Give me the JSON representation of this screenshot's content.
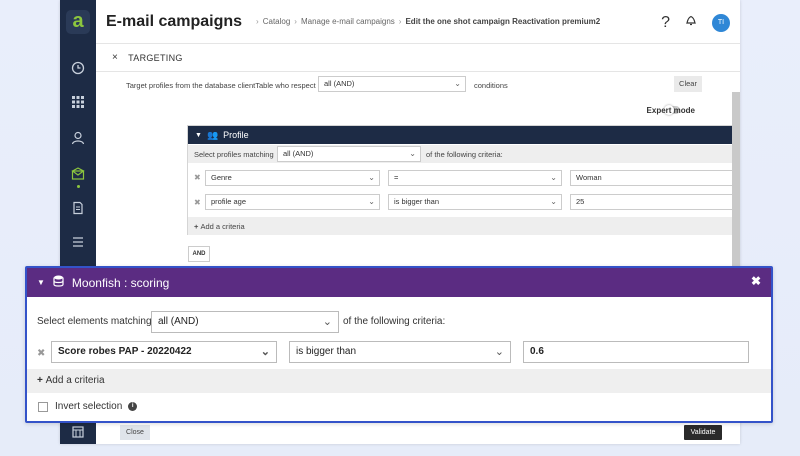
{
  "app": {
    "logo": "a",
    "title": "E-mail campaigns",
    "breadcrumb": [
      "Catalog",
      "Manage e-mail campaigns",
      "Edit the one shot campaign Reactivation premium2"
    ],
    "help": "?",
    "avatar": "TI"
  },
  "sidebar": {
    "icons": [
      "clock-icon",
      "grid-icon",
      "user-icon",
      "envelope-icon",
      "document-icon",
      "list-icon",
      "store-icon"
    ]
  },
  "targeting": {
    "section_title": "TARGETING",
    "intro_prefix": "Target profiles from the database clientTable who respect",
    "intro_select": "all (AND)",
    "intro_suffix": "conditions",
    "clear_label": "Clear",
    "expert_mode_label": "Expert mode"
  },
  "profile": {
    "title": "Profile",
    "match_prefix": "Select profiles matching",
    "match_select": "all (AND)",
    "match_suffix": "of the following criteria:",
    "criteria": [
      {
        "field": "Genre",
        "operator": "=",
        "value": "Woman"
      },
      {
        "field": "profile age",
        "operator": "is bigger than",
        "value": "25"
      }
    ],
    "add_label": "Add a criteria",
    "and_label": "AND"
  },
  "moonfish": {
    "title": "Moonfish : scoring",
    "match_prefix": "Select elements matching",
    "match_select": "all (AND)",
    "match_suffix": "of the following criteria:",
    "criteria": [
      {
        "field": "Score robes PAP - 20220422",
        "operator": "is bigger than",
        "value": "0.6"
      }
    ],
    "add_label": "Add a criteria",
    "invert_label": "Invert selection"
  },
  "footer": {
    "close_label": "Close",
    "validate_label": "Validate"
  },
  "colors": {
    "sidebar": "#1d2b45",
    "accent_green": "#8cc63e",
    "moonfish_header": "#5b2c82",
    "highlight_border": "#3453c9",
    "avatar": "#2f87d6"
  }
}
